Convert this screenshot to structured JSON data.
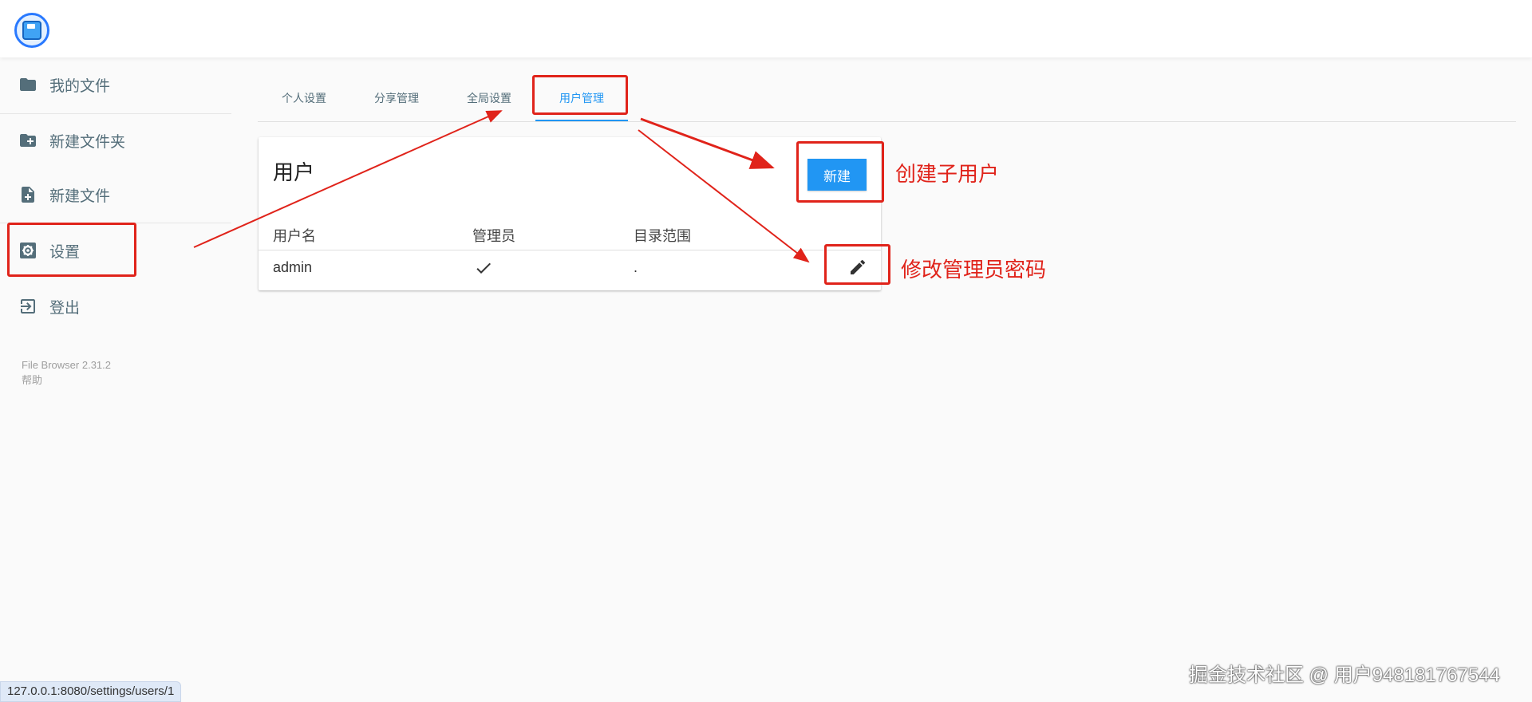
{
  "sidebar": {
    "items": [
      {
        "label": "我的文件",
        "icon": "folder-icon"
      },
      {
        "label": "新建文件夹",
        "icon": "folder-plus-icon"
      },
      {
        "label": "新建文件",
        "icon": "file-plus-icon"
      },
      {
        "label": "设置",
        "icon": "gear-icon"
      },
      {
        "label": "登出",
        "icon": "logout-icon"
      }
    ],
    "version": "File Browser 2.31.2",
    "help": "帮助"
  },
  "tabs": [
    {
      "label": "个人设置"
    },
    {
      "label": "分享管理"
    },
    {
      "label": "全局设置"
    },
    {
      "label": "用户管理",
      "active": true
    }
  ],
  "users_card": {
    "title": "用户",
    "new_button": "新建",
    "columns": [
      "用户名",
      "管理员",
      "目录范围"
    ],
    "rows": [
      {
        "username": "admin",
        "admin": true,
        "scope": "."
      }
    ]
  },
  "annotations": {
    "create_user": "创建子用户",
    "change_password": "修改管理员密码"
  },
  "status_url": "127.0.0.1:8080/settings/users/1",
  "watermark": "掘金技术社区 @ 用户948181767544",
  "colors": {
    "accent": "#2196f3",
    "annotation": "#e0231a",
    "sidebar_text": "#546e7a"
  }
}
